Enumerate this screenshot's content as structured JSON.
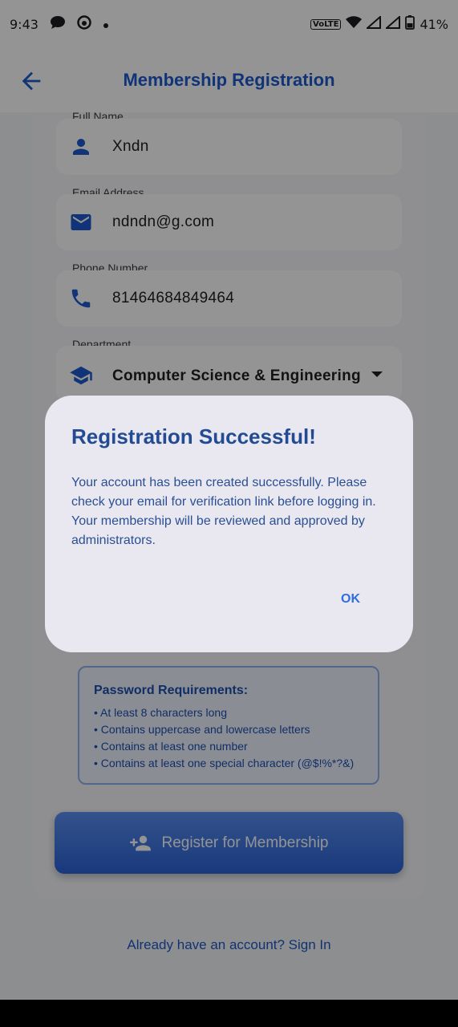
{
  "status": {
    "time": "9:43",
    "volte": "VoLTE",
    "battery": "41%"
  },
  "header": {
    "title": "Membership Registration"
  },
  "form": {
    "full_name": {
      "label": "Full Name",
      "value": "Xndn"
    },
    "email": {
      "label": "Email Address",
      "value": "ndndn@g.com"
    },
    "phone": {
      "label": "Phone Number",
      "value": "81464684849464"
    },
    "department": {
      "label": "Department",
      "value": "Computer Science & Engineering"
    }
  },
  "requirements": {
    "title": "Password Requirements:",
    "items": [
      "• At least 8 characters long",
      "• Contains uppercase and lowercase letters",
      "• Contains at least one number",
      "• Contains at least one special character (@$!%*?&)"
    ]
  },
  "register_button": "Register for Membership",
  "signin_link": "Already have an account? Sign In",
  "dialog": {
    "title": "Registration Successful!",
    "body": "Your account has been created successfully. Please check your email for verification link before logging in. Your membership will be reviewed and approved by administrators.",
    "ok_label": "OK"
  },
  "colors": {
    "primary": "#1e5ad0",
    "dialog_title": "#234b94",
    "dialog_bg": "#e9e8f1"
  }
}
